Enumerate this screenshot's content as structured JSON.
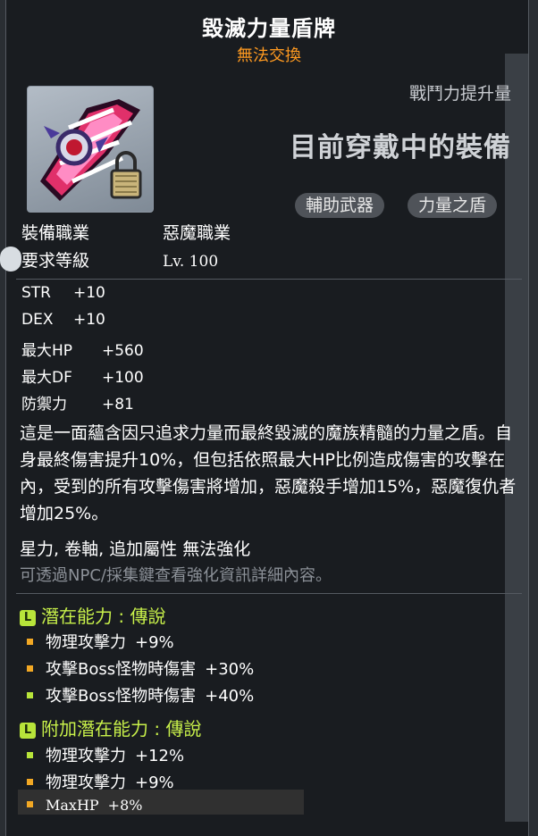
{
  "item": {
    "name": "毀滅力量盾牌",
    "tradability": "無法交換",
    "icon": "demon-shield-icon",
    "power_label": "戰鬥力提升量",
    "equipped_label": "目前穿戴中的裝備",
    "tags": [
      "輔助武器",
      "力量之盾"
    ]
  },
  "requirements": {
    "job_label": "裝備職業",
    "job_value": "惡魔職業",
    "level_label": "要求等級",
    "level_value": "Lv. 100"
  },
  "stats": [
    {
      "name": "STR",
      "value": "+10"
    },
    {
      "name": "DEX",
      "value": "+10"
    },
    {
      "name": "最大HP",
      "value": "+560"
    },
    {
      "name": "最大DF",
      "value": "+100"
    },
    {
      "name": "防禦力",
      "value": "+81"
    }
  ],
  "description": "這是一面蘊含因只追求力量而最終毀滅的魔族精髓的力量之盾。自身最終傷害提升10%，但包括依照最大HP比例造成傷害的攻擊在內，受到的所有攻擊傷害將增加，惡魔殺手增加15%，惡魔復仇者增加25%。",
  "enhance_text": "星力, 卷軸, 追加屬性 無法強化",
  "hint_text": "可透過NPC/採集鍵查看強化資訊詳細內容。",
  "potential": {
    "badge": "L",
    "title": "潛在能力 : 傳說",
    "lines": [
      {
        "name": "物理攻擊力",
        "value": "+9%",
        "color": "#f2a824"
      },
      {
        "name": "攻擊Boss怪物時傷害",
        "value": "+30%",
        "color": "#f2a824"
      },
      {
        "name": "攻擊Boss怪物時傷害",
        "value": "+40%",
        "color": "#b8e43a"
      }
    ]
  },
  "additional_potential": {
    "badge": "L",
    "title": "附加潛在能力 : 傳說",
    "lines": [
      {
        "name": "物理攻擊力",
        "value": "+12%",
        "color": "#b8e43a"
      },
      {
        "name": "物理攻擊力",
        "value": "+9%",
        "color": "#f2a824"
      },
      {
        "name": "MaxHP",
        "value": "+8%",
        "color": "#f2a824"
      }
    ]
  }
}
